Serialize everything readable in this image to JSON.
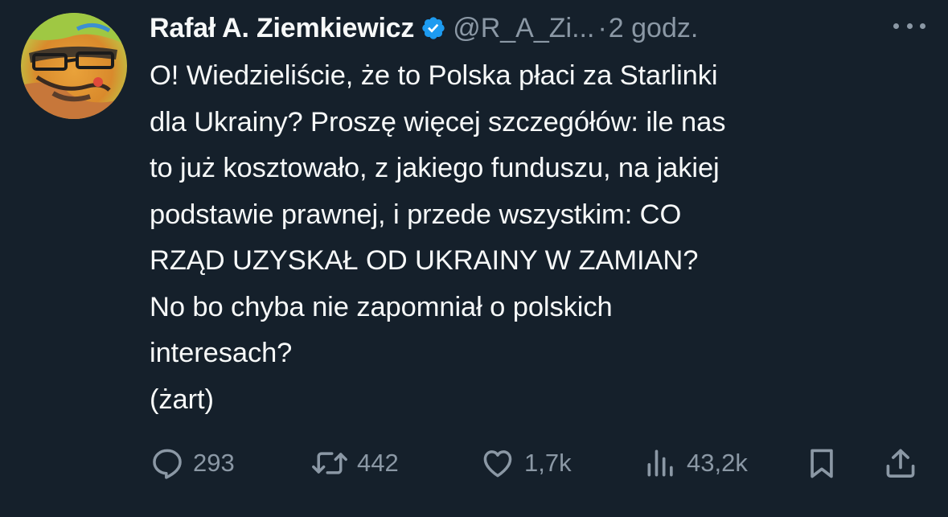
{
  "author": {
    "name": "Rafał A. Ziemkiewicz",
    "handle": "@R_A_Zi...",
    "separator": "·",
    "time": "2 godz."
  },
  "tweet": {
    "text": "O! Wiedzieliście, że to Polska płaci za Starlinki\ndla Ukrainy? Proszę więcej szczegółów: ile nas\nto już kosztowało, z jakiego funduszu, na jakiej\npodstawie prawnej, i przede wszystkim: CO\nRZĄD UZYSKAŁ OD UKRAINY W ZAMIAN?\nNo bo chyba nie zapomniał o polskich\ninteresach?\n(żart)"
  },
  "actions": {
    "replies": "293",
    "retweets": "442",
    "likes": "1,7k",
    "views": "43,2k"
  },
  "icons": {
    "verified": "verified-badge-icon",
    "more": "more-dots-icon",
    "reply": "reply-bubble-icon",
    "retweet": "retweet-icon",
    "like": "heart-icon",
    "views": "bar-chart-icon",
    "bookmark": "bookmark-icon",
    "share": "share-icon"
  },
  "colors": {
    "background": "#15202b",
    "text": "#f7f9f9",
    "secondary": "#8b98a5",
    "verified": "#1d9bf0"
  }
}
